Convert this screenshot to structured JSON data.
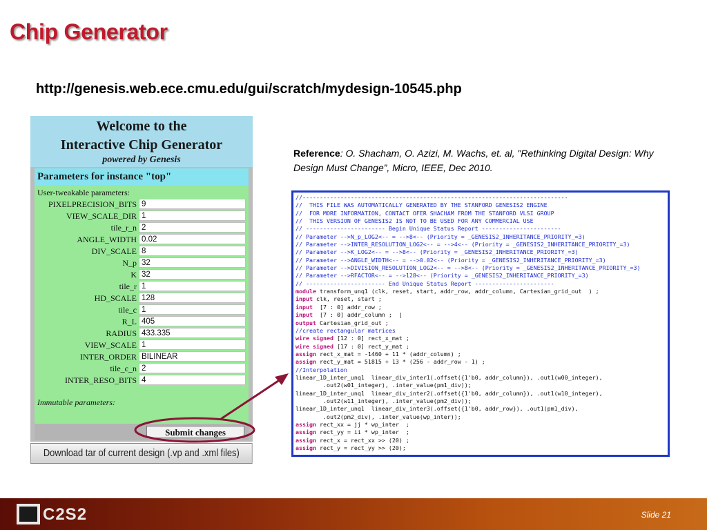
{
  "title": "Chip Generator",
  "url": "http://genesis.web.ece.cmu.edu/gui/scratch/mydesign-10545.php",
  "welcome": {
    "line1": "Welcome to the",
    "line2": "Interactive Chip Generator",
    "line3": "powered by Genesis"
  },
  "form": {
    "header": "Parameters for instance \"top\"",
    "tweakable_label": "User-tweakable parameters:",
    "params": [
      {
        "label": "PIXELPRECISION_BITS",
        "value": "9"
      },
      {
        "label": "VIEW_SCALE_DIR",
        "value": "1"
      },
      {
        "label": "tile_r_n",
        "value": "2"
      },
      {
        "label": "ANGLE_WIDTH",
        "value": "0.02"
      },
      {
        "label": "DIV_SCALE",
        "value": "8"
      },
      {
        "label": "N_p",
        "value": "32"
      },
      {
        "label": "K",
        "value": "32"
      },
      {
        "label": "tile_r",
        "value": "1"
      },
      {
        "label": "HD_SCALE",
        "value": "128"
      },
      {
        "label": "tile_c",
        "value": "1"
      },
      {
        "label": "R_L",
        "value": "405"
      },
      {
        "label": "RADIUS",
        "value": "433.335"
      },
      {
        "label": "VIEW_SCALE",
        "value": "1"
      },
      {
        "label": "INTER_ORDER",
        "value": "BILINEAR"
      },
      {
        "label": "tile_c_n",
        "value": "2"
      },
      {
        "label": "INTER_RESO_BITS",
        "value": "4"
      }
    ],
    "immutable_label": "Immutable parameters:",
    "submit_label": "Submit changes",
    "download_label": "Download tar of current design (.vp and .xml files)"
  },
  "reference": {
    "label": "Reference",
    "colon": ":",
    "text": " O. Shacham, O. Azizi, M. Wachs, et. al, \"Rethinking Digital Design: Why Design Must Change”, Micro, IEEE, Dec 2010."
  },
  "code": [
    {
      "kind": "comment",
      "text": "//-----------------------------------------------------------------------------"
    },
    {
      "kind": "comment",
      "text": "//  THIS FILE WAS AUTOMATICALLY GENERATED BY THE STANFORD GENESIS2 ENGINE"
    },
    {
      "kind": "comment",
      "text": "//  FOR MORE INFORMATION, CONTACT OFER SHACHAM FROM THE STANFORD VLSI GROUP"
    },
    {
      "kind": "comment",
      "text": "//  THIS VERSION OF GENESIS2 IS NOT TO BE USED FOR ANY COMMERCIAL USE"
    },
    {
      "kind": "comment",
      "text": "// ----------------------- Begin Unique Status Report -----------------------"
    },
    {
      "kind": "comment",
      "text": "// Parameter -->N_p_LOG2<-- = -->8<-- (Priority = _GENESIS2_INHERITANCE_PRIORITY_=3)"
    },
    {
      "kind": "comment",
      "text": "// Parameter -->INTER_RESOLUTION_LOG2<-- = -->4<-- (Priority = _GENESIS2_INHERITANCE_PRIORITY_=3)"
    },
    {
      "kind": "comment",
      "text": "// Parameter -->K_LOG2<-- = -->8<-- (Priority = _GENESIS2_INHERITANCE_PRIORITY_=3)"
    },
    {
      "kind": "comment",
      "text": "// Parameter -->ANGLE_WIDTH<-- = -->0.02<-- (Priority = _GENESIS2_INHERITANCE_PRIORITY_=3)"
    },
    {
      "kind": "comment",
      "text": "// Parameter -->DIVISION_RESOLUTION_LOG2<-- = -->8<-- (Priority = _GENESIS2_INHERITANCE_PRIORITY_=3)"
    },
    {
      "kind": "comment",
      "text": "// Parameter -->RFACTOR<-- = -->128<-- (Priority = _GENESIS2_INHERITANCE_PRIORITY_=3)"
    },
    {
      "kind": "comment",
      "text": "// ----------------------- End Unique Status Report -----------------------"
    },
    {
      "kind": "mixed",
      "kw": "module",
      "text": " transform_unq1 (clk, reset, start, addr_row, addr_column, Cartesian_grid_out  ) ;"
    },
    {
      "kind": "mixed",
      "kw": "input",
      "text": " clk, reset, start ;"
    },
    {
      "kind": "mixed",
      "kw": "input",
      "text": "  [7 : 0] addr_row ;"
    },
    {
      "kind": "mixed",
      "kw": "input",
      "text": "  [7 : 0] addr_column ;  |"
    },
    {
      "kind": "mixed",
      "kw": "output",
      "text": " Cartesian_grid_out ;"
    },
    {
      "kind": "comment",
      "text": "//create rectangular matrices"
    },
    {
      "kind": "mixed",
      "kw": "wire signed",
      "text": " [12 : 0] rect_x_mat ;"
    },
    {
      "kind": "mixed",
      "kw": "wire signed",
      "text": " [17 : 0] rect_y_mat ;"
    },
    {
      "kind": "mixed",
      "kw": "assign",
      "text": " rect_x_mat = -1460 + 11 * (addr_column) ;"
    },
    {
      "kind": "mixed",
      "kw": "assign",
      "text": " rect_y_mat = 51815 + 13 * (256 - addr_row - 1) ;"
    },
    {
      "kind": "comment",
      "text": "//Interpolation"
    },
    {
      "kind": "plain",
      "text": "linear_1D_inter_unq1  linear_div_inter1(.offset({1'b0, addr_column}), .out1(w00_integer),"
    },
    {
      "kind": "plain",
      "text": "        .out2(w01_integer), .inter_value(pm1_div));"
    },
    {
      "kind": "plain",
      "text": "linear_1D_inter_unq1  linear_div_inter2(.offset({1'b0, addr_column}), .out1(w10_integer),"
    },
    {
      "kind": "plain",
      "text": "        .out2(w11_integer), .inter_value(pm2_div));"
    },
    {
      "kind": "plain",
      "text": "linear_1D_inter_unq1  linear_div_inter3(.offset({1'b0, addr_row}), .out1(pm1_div),"
    },
    {
      "kind": "plain",
      "text": "        .out2(pm2_div), .inter_value(wp_inter));"
    },
    {
      "kind": "mixed",
      "kw": "assign",
      "text": " rect_xx = jj * wp_inter  ;"
    },
    {
      "kind": "mixed",
      "kw": "assign",
      "text": " rect_yy = ii * wp_inter  ;"
    },
    {
      "kind": "mixed",
      "kw": "assign",
      "text": " rect_x = rect_xx >> (20) ;"
    },
    {
      "kind": "mixed",
      "kw": "assign",
      "text": " rect_y = rect_yy >> (20);"
    }
  ],
  "footer": {
    "logo_text": "C2S2",
    "slide": "Slide 21"
  },
  "colors": {
    "title": "#c0192b",
    "code_border": "#1f38c8",
    "highlight": "#8b1535"
  }
}
